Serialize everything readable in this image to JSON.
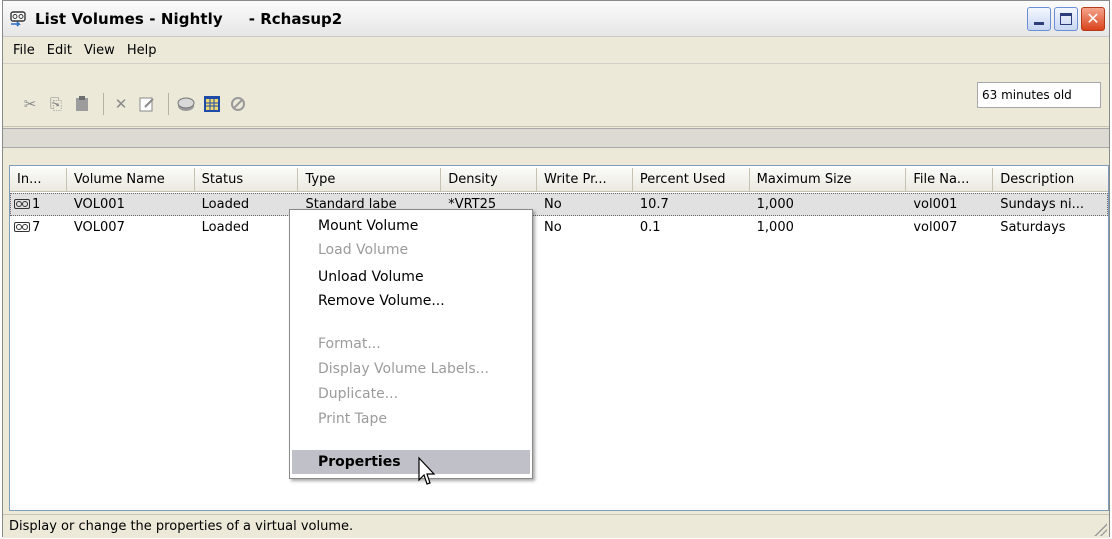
{
  "window": {
    "title": "List Volumes - Nightly",
    "subtitle": "- Rchasup2",
    "controls": [
      "minimize",
      "maximize",
      "close"
    ]
  },
  "menu": [
    "File",
    "Edit",
    "View",
    "Help"
  ],
  "toolbar": {
    "icons": [
      "cut-icon",
      "copy-icon",
      "paste-icon",
      "delete-icon",
      "properties-icon",
      "refresh-icon",
      "columns-icon",
      "stop-icon"
    ],
    "age": "63 minutes old"
  },
  "columns": [
    "In...",
    "Volume Name",
    "Status",
    "Type",
    "Density",
    "Write Pr...",
    "Percent Used",
    "Maximum Size",
    "File Na...",
    "Description"
  ],
  "rows": [
    {
      "index": "1",
      "name": "VOL001",
      "status": "Loaded",
      "type": "Standard labe",
      "density": "*VRT25",
      "write": "No",
      "percent": "10.7",
      "max": "1,000",
      "file": "vol001",
      "desc": "Sundays ni..."
    },
    {
      "index": "7",
      "name": "VOL007",
      "status": "Loaded",
      "type": "",
      "density": "",
      "write": "No",
      "percent": "0.1",
      "max": "1,000",
      "file": "vol007",
      "desc": "Saturdays"
    }
  ],
  "context_menu": {
    "mount": "Mount Volume",
    "load": "Load Volume",
    "unload": "Unload Volume",
    "remove": "Remove Volume...",
    "format": "Format...",
    "display_labels": "Display Volume Labels...",
    "duplicate": "Duplicate...",
    "print": "Print Tape",
    "properties": "Properties"
  },
  "status": "Display or change the properties of a virtual volume.",
  "colors": {
    "title_bar": "#ece9d8",
    "close_button": "#d9431c",
    "menu_highlight": "#c0c0c8"
  }
}
